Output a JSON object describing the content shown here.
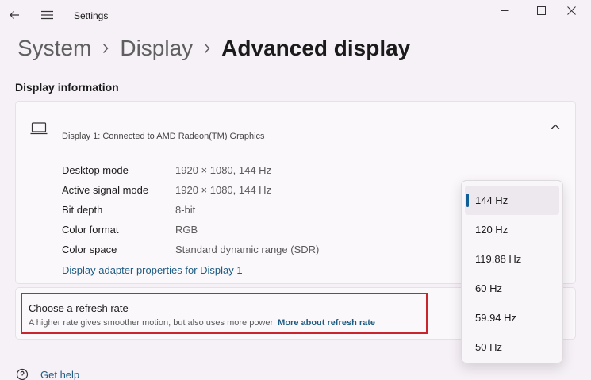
{
  "window": {
    "app_title": "Settings"
  },
  "breadcrumb": {
    "items": [
      "System",
      "Display",
      "Advanced display"
    ]
  },
  "section": {
    "title": "Display information"
  },
  "display_card": {
    "name": "Display 1: Connected to AMD Radeon(TM) Graphics",
    "rows": [
      {
        "label": "Desktop mode",
        "value": "1920 × 1080, 144 Hz"
      },
      {
        "label": "Active signal mode",
        "value": "1920 × 1080, 144 Hz"
      },
      {
        "label": "Bit depth",
        "value": "8-bit"
      },
      {
        "label": "Color format",
        "value": "RGB"
      },
      {
        "label": "Color space",
        "value": "Standard dynamic range (SDR)"
      }
    ],
    "adapter_link": "Display adapter properties for Display 1"
  },
  "refresh": {
    "title": "Choose a refresh rate",
    "description": "A higher rate gives smoother motion, but also uses more power",
    "link": "More about refresh rate"
  },
  "dropdown": {
    "options": [
      "144 Hz",
      "120 Hz",
      "119.88 Hz",
      "60 Hz",
      "59.94 Hz",
      "50 Hz"
    ],
    "selected": "144 Hz"
  },
  "footer": {
    "get_help": "Get help"
  },
  "colors": {
    "accent": "#0f5f96",
    "link": "#1f5c83",
    "highlight": "#c8252c",
    "background": "#f6f1f7"
  },
  "icons": {
    "back": "back-arrow-icon",
    "menu": "hamburger-menu-icon",
    "minimize": "minimize-icon",
    "maximize": "maximize-icon",
    "close": "close-icon",
    "monitor": "laptop-monitor-icon",
    "collapse": "chevron-up-icon",
    "help": "help-icon"
  }
}
